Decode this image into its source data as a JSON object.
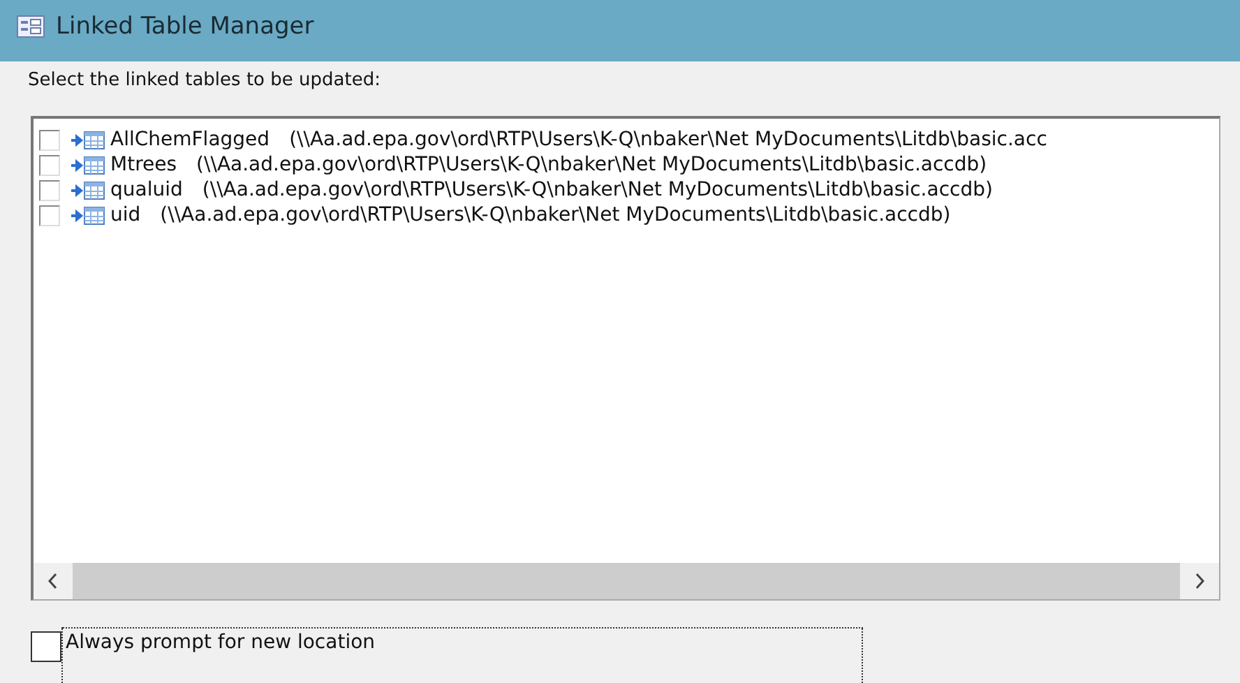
{
  "window": {
    "title": "Linked Table Manager"
  },
  "prompt": "Select the linked tables to be updated:",
  "tables": [
    {
      "name": "AllChemFlagged",
      "path": "(\\\\Aa.ad.epa.gov\\ord\\RTP\\Users\\K-Q\\nbaker\\Net MyDocuments\\Litdb\\basic.acc",
      "checked": false
    },
    {
      "name": "Mtrees",
      "path": "(\\\\Aa.ad.epa.gov\\ord\\RTP\\Users\\K-Q\\nbaker\\Net MyDocuments\\Litdb\\basic.accdb)",
      "checked": false
    },
    {
      "name": "qualuid",
      "path": "(\\\\Aa.ad.epa.gov\\ord\\RTP\\Users\\K-Q\\nbaker\\Net MyDocuments\\Litdb\\basic.accdb)",
      "checked": false
    },
    {
      "name": "uid",
      "path": "(\\\\Aa.ad.epa.gov\\ord\\RTP\\Users\\K-Q\\nbaker\\Net MyDocuments\\Litdb\\basic.accdb)",
      "checked": false
    }
  ],
  "always_prompt": {
    "label": "Always prompt for new location",
    "checked": false
  }
}
